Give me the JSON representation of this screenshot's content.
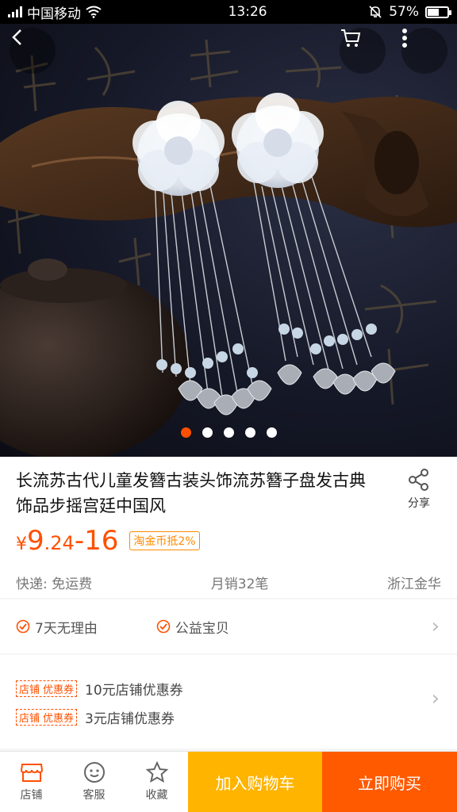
{
  "status_bar": {
    "carrier": "中国移动",
    "time": "13:26",
    "battery": "57%",
    "battery_level": 0.57
  },
  "hero": {
    "image_count": 5,
    "active_index": 0
  },
  "product": {
    "title": "长流苏古代儿童发簪古装头饰流苏簪子盘发古典饰品步摇宫廷中国风",
    "share_label": "分享",
    "price": {
      "symbol": "¥",
      "int": "9",
      "dec": ".24",
      "range_end": "-16"
    },
    "coin_tag": "淘金币抵2%",
    "shipping": "快递: 免运费",
    "monthly_sales": "月销32笔",
    "location": "浙江金华"
  },
  "services": [
    {
      "label": "7天无理由"
    },
    {
      "label": "公益宝贝"
    }
  ],
  "coupons": [
    {
      "tag1": "店铺",
      "tag2": "优惠券",
      "text": "10元店铺优惠券"
    },
    {
      "tag1": "店铺",
      "tag2": "优惠券",
      "text": "3元店铺优惠券"
    }
  ],
  "bottom": {
    "store": "店铺",
    "service": "客服",
    "favorite": "收藏",
    "add_to_cart": "加入购物车",
    "buy_now": "立即购买"
  },
  "colors": {
    "accent": "#ff5000",
    "cart": "#ffb400",
    "buy": "#ff5a00"
  }
}
